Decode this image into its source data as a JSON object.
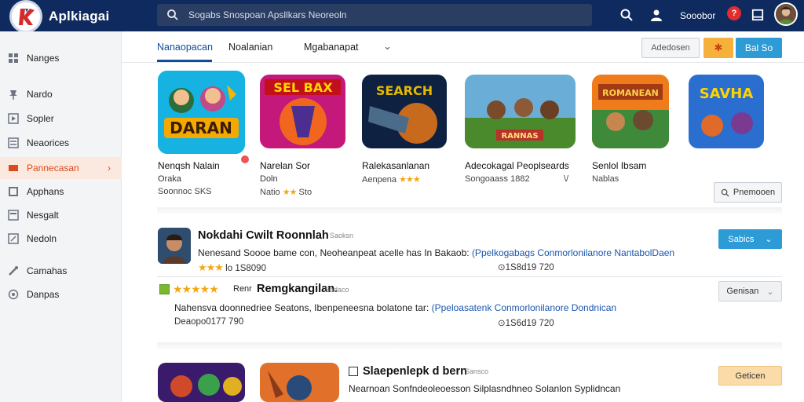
{
  "app": {
    "title": "Aplkiagai"
  },
  "search": {
    "placeholder": "Sogabs Snospoan Apsllkars Neoreoln"
  },
  "topbar": {
    "user_label": "Sooobor",
    "notif_count": "?"
  },
  "sidebar": {
    "items": [
      {
        "label": "Nanges",
        "icon": "grid-icon"
      },
      {
        "label": "Nardo",
        "icon": "pin-icon"
      },
      {
        "label": "Sopler",
        "icon": "play-icon"
      },
      {
        "label": "Neaorices",
        "icon": "news-icon"
      },
      {
        "label": "Pannecasan",
        "icon": "library-icon",
        "active": true
      },
      {
        "label": "Apphans",
        "icon": "apps-icon"
      },
      {
        "label": "Nesgalt",
        "icon": "doc-icon"
      },
      {
        "label": "Nedoln",
        "icon": "edit-icon"
      },
      {
        "label": "Camahas",
        "icon": "tools-icon"
      },
      {
        "label": "Danpas",
        "icon": "globe-icon"
      }
    ]
  },
  "tabs": [
    {
      "label": "Nanaopacan",
      "active": true
    },
    {
      "label": "Noalanian"
    },
    {
      "label": "Mgabanapat"
    }
  ],
  "toolbar": {
    "outline_label": "Adedosen",
    "orange_label": "✱",
    "blue_label": "Bal So"
  },
  "featured": [
    {
      "title": "Nenqsh Nalain",
      "sub": "Oraka",
      "meta": "Soonnoc SKS",
      "thumb_text": "DARAN"
    },
    {
      "title": "Narelan Sor",
      "sub": "Doln",
      "meta": "Natio",
      "rating": "★★",
      "meta2": "Sto",
      "thumb_text": "SEL BAX"
    },
    {
      "title": "Ralekasanlanan",
      "sub": "Aenpena",
      "rating": "★★★",
      "thumb_text": "SEARCH"
    },
    {
      "title": "Adecokagal Peoplseards",
      "sub": "Songoaass 1882",
      "extra": "\\/",
      "thumb_text": "RANNAS"
    },
    {
      "title": "Senlol Ibsam",
      "sub": "Nablas",
      "thumb_text": "ROMANEAN"
    },
    {
      "title": "",
      "sub": "",
      "thumb_text": "SAVHA"
    }
  ],
  "promo_button": "Pnemooen",
  "reviews": [
    {
      "title": "Nokdahi Cwilt Roonnlah",
      "tag": "Saoksn",
      "text": "Nenesand Soooe bame con, Neoheanpeat acelle has In Bakaob:",
      "link": "(Ppelkogabags Conmorlonilanore NantabolDaen",
      "stars": "★★★",
      "meta": "lo 1S8090",
      "meta2": "⊙1S8d19 720",
      "button": "Sabics"
    },
    {
      "title": "Remgkangilan.",
      "prefix": "Renr",
      "tag": "Sadaco",
      "text": "Nahensva doonnedriee Seatons, Ibenpeneesna bolatone tar:",
      "link": "(Ppeloasatenk Conmorlonilanore Dondnican",
      "stars": "★★★★★",
      "meta": "Deaopo0177 790",
      "meta2": "⊙1S6d19 720",
      "button": "Genisan"
    },
    {
      "title": "Slaepenlepk d bern",
      "tag": "Sansco",
      "text": "Nearnoan Sonfndeoleoesson Silplasndhneo Solanlon Syplidncan",
      "button": "Geticen"
    }
  ]
}
